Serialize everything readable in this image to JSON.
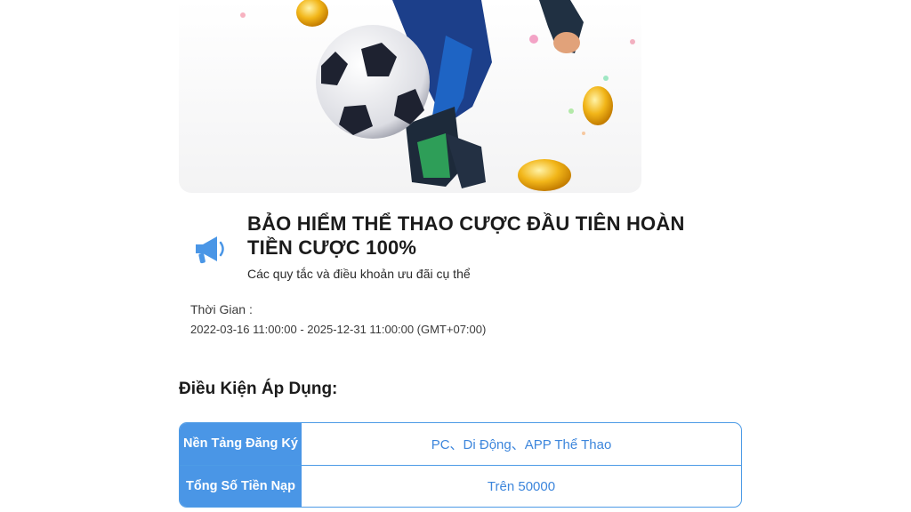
{
  "promo": {
    "title": "BẢO HIỂM THỂ THAO CƯỢC ĐẦU TIÊN HOÀN TIỀN CƯỢC 100%",
    "subtitle": "Các quy tắc và điều khoản ưu đãi cụ thể",
    "icon": "megaphone-icon"
  },
  "time": {
    "label": "Thời Gian :",
    "value": "2022-03-16 11:00:00 - 2025-12-31 11:00:00 (GMT+07:00)"
  },
  "conditions": {
    "title": "Điều Kiện Áp Dụng:",
    "rows": [
      {
        "key": "Nền Tảng Đăng Ký",
        "value": "PC、Di Động、APP Thể Thao"
      },
      {
        "key": "Tổng Số Tiền Nạp",
        "value": "Trên 50000"
      }
    ]
  },
  "colors": {
    "accent": "#4a96e6",
    "value_text": "#3d86dc",
    "title_text": "#1b1b1b"
  }
}
